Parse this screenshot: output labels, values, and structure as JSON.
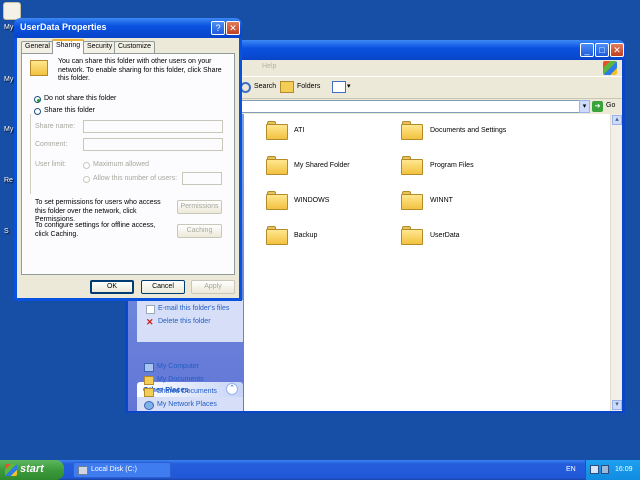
{
  "desktop": {
    "icons": [
      {
        "label": "My I"
      },
      {
        "label": "My"
      },
      {
        "label": "My"
      },
      {
        "label": "Re"
      },
      {
        "label": "S"
      }
    ]
  },
  "explorer": {
    "menu_visible_text": "Help",
    "toolbar": {
      "search_label": "Search",
      "folders_label": "Folders"
    },
    "address": {
      "go_label": "Go"
    },
    "file_tasks": {
      "items": [
        {
          "label": "E-mail this folder's files",
          "icon": "mail-icon"
        },
        {
          "label": "Delete this folder",
          "icon": "delete-icon"
        }
      ]
    },
    "other_places": {
      "title": "Other Places",
      "items": [
        {
          "label": "My Computer",
          "icon": "computer-icon"
        },
        {
          "label": "My Documents",
          "icon": "documents-icon"
        },
        {
          "label": "Shared Documents",
          "icon": "folder-icon"
        },
        {
          "label": "My Network Places",
          "icon": "network-icon"
        }
      ]
    },
    "folders": [
      {
        "name": "ATI"
      },
      {
        "name": "Documents and Settings"
      },
      {
        "name": "My Shared Folder"
      },
      {
        "name": "Program Files"
      },
      {
        "name": "WINDOWS"
      },
      {
        "name": "WINNT"
      },
      {
        "name": "Backup"
      },
      {
        "name": "UserData"
      }
    ]
  },
  "dialog": {
    "title": "UserData Properties",
    "tabs": [
      "General",
      "Sharing",
      "Security",
      "Customize"
    ],
    "intro": "You can share this folder with other users on your network.  To enable sharing for this folder, click Share this folder.",
    "options": {
      "do_not_share": "Do not share this folder",
      "share": "Share this folder"
    },
    "share_name_label": "Share name:",
    "comment_label": "Comment:",
    "user_limit_label": "User limit:",
    "maximum_allowed": "Maximum allowed",
    "allow_this_number": "Allow this number of users:",
    "permissions_text": "To set permissions for users who access this folder over the network, click Permissions.",
    "permissions_button": "Permissions",
    "caching_text": "To configure settings for offline access, click Caching.",
    "caching_button": "Caching",
    "buttons": {
      "ok": "OK",
      "cancel": "Cancel",
      "apply": "Apply"
    }
  },
  "taskbar": {
    "start_label": "start",
    "task_label": "Local Disk (C:)",
    "language": "EN",
    "clock": "16:09"
  },
  "colors": {
    "desktop": "#174ea6",
    "xp_blue": "#0a52e0",
    "start_green": "#3c9a3c",
    "link_blue": "#215dc6",
    "dialog_face": "#ece9d8"
  }
}
